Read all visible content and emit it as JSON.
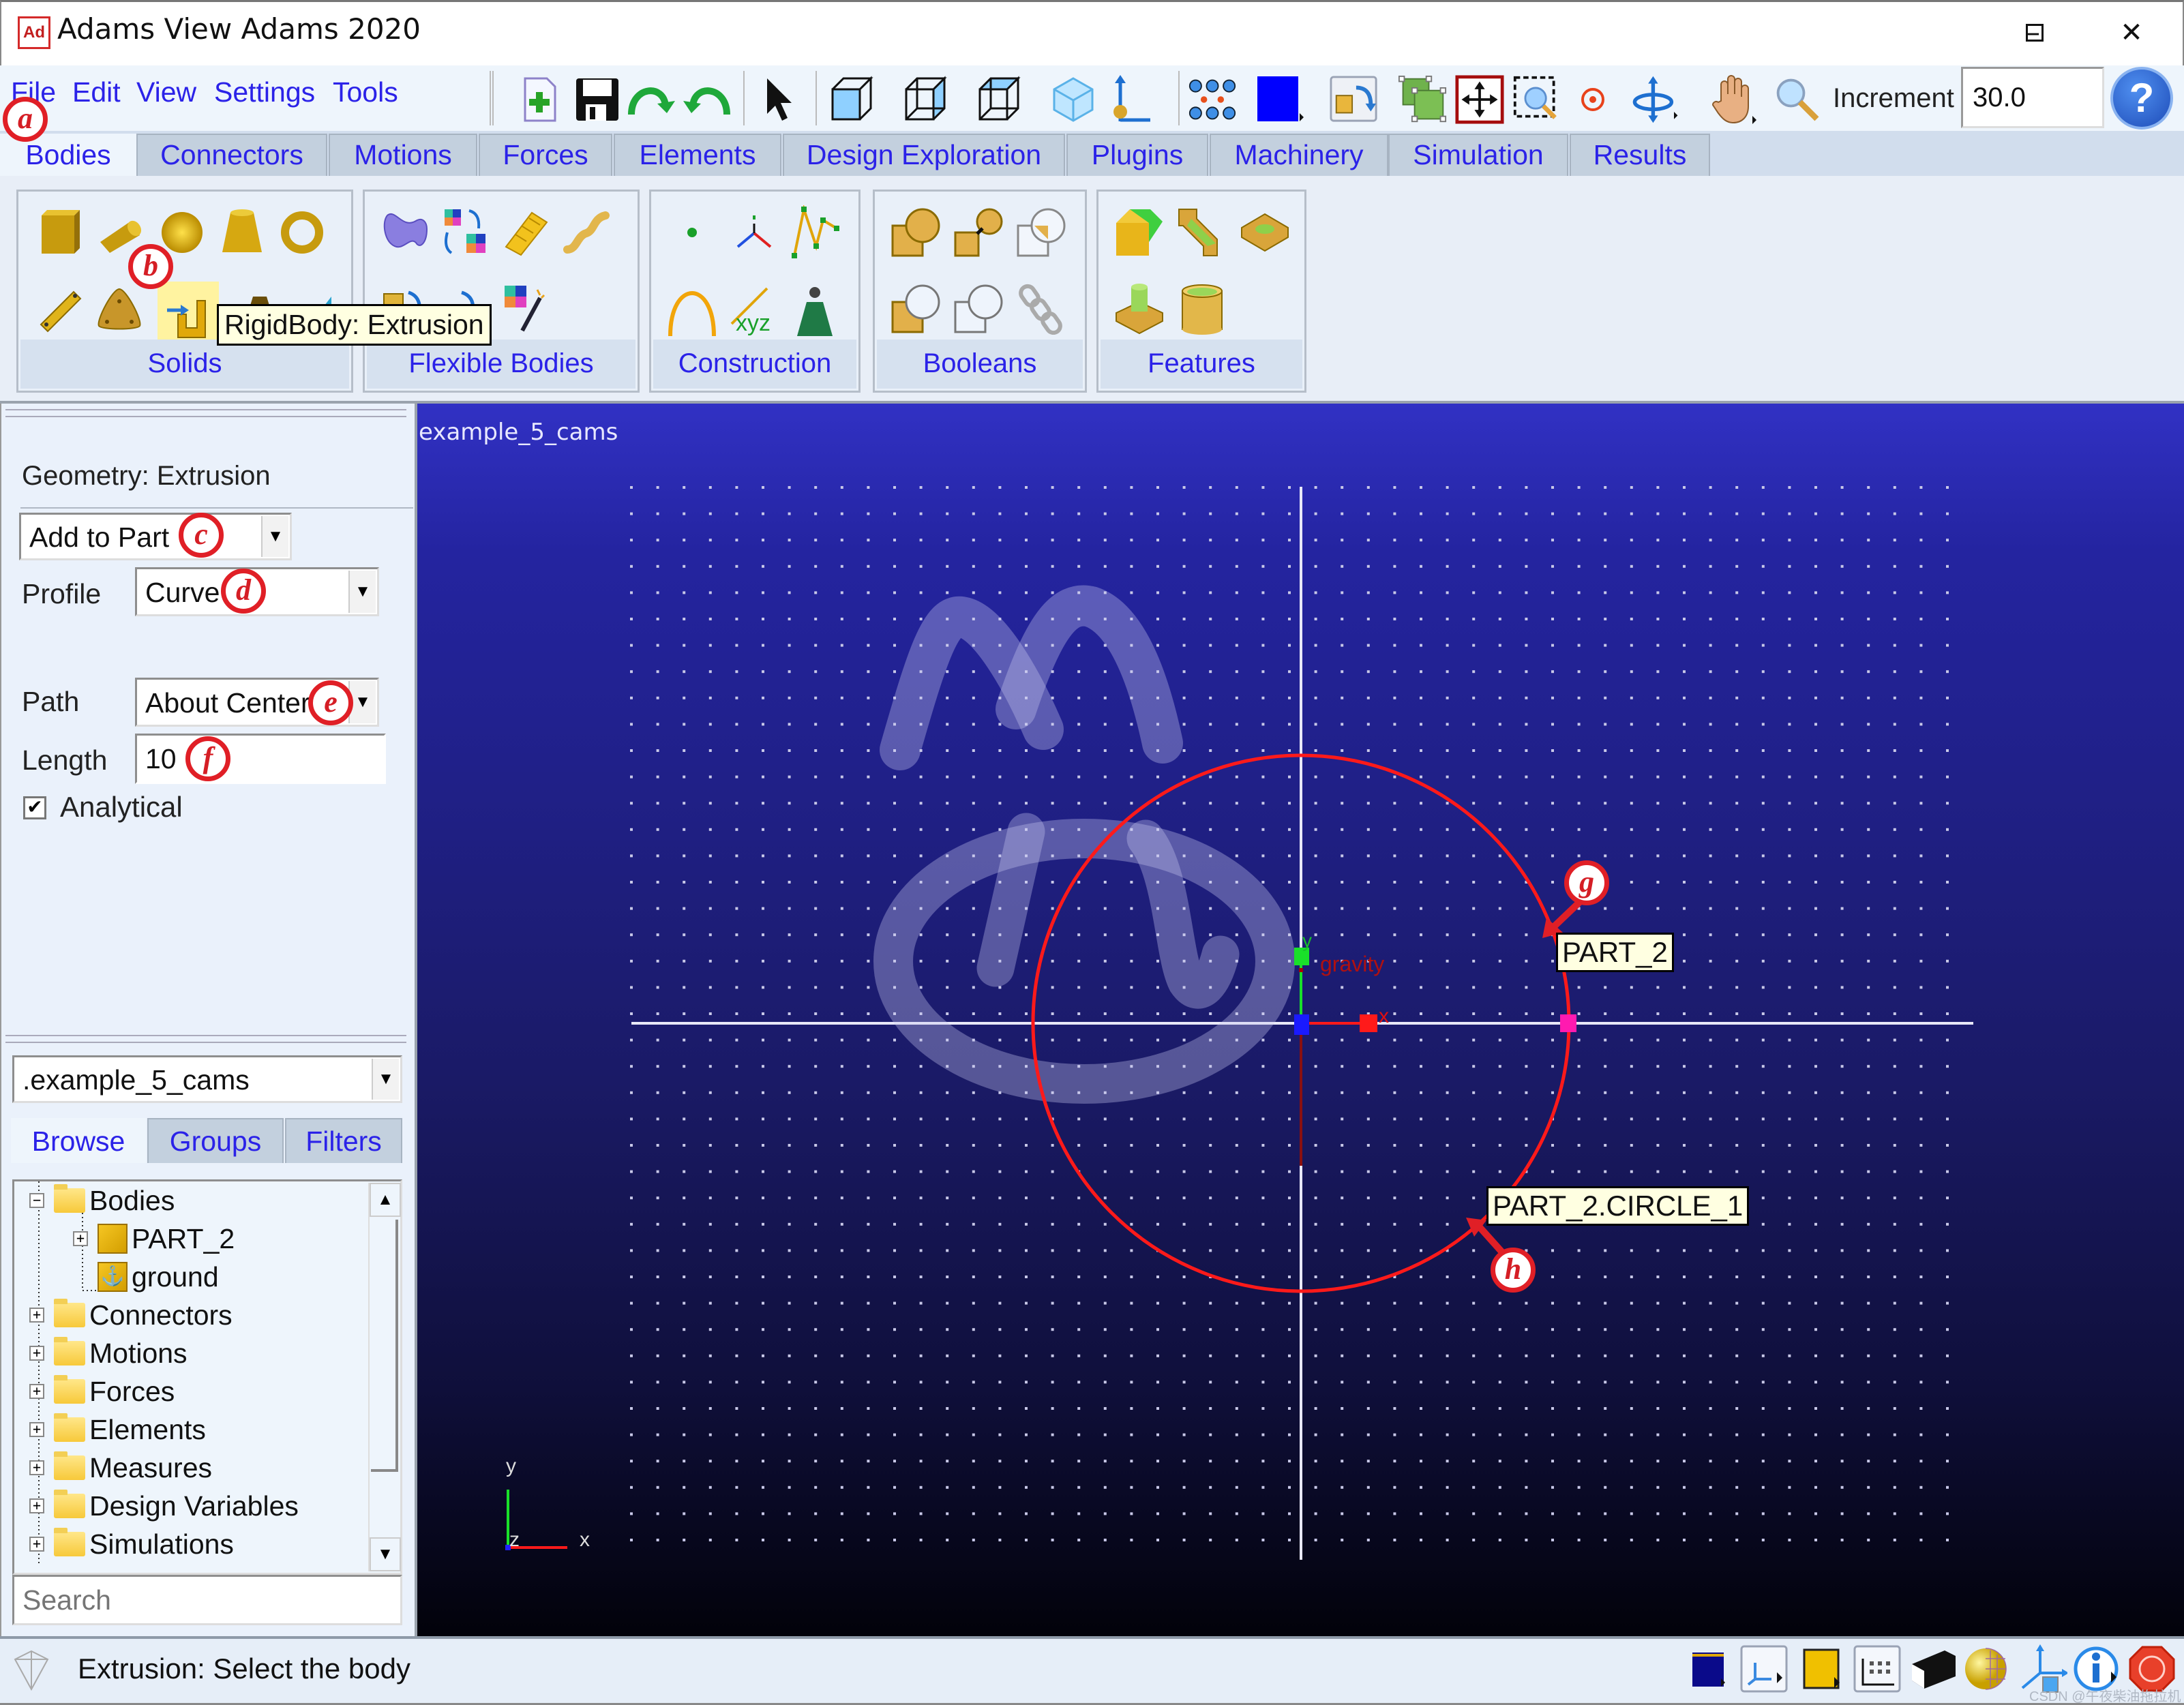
{
  "window": {
    "title": "Adams View Adams 2020",
    "logo_text": "Ad",
    "controls": {
      "minimize": "–",
      "maximize": "☐",
      "close": "✕"
    }
  },
  "menu": [
    "File",
    "Edit",
    "View",
    "Settings",
    "Tools"
  ],
  "toolbar": {
    "icons": [
      "new-model-icon",
      "save-icon",
      "undo-icon",
      "redo-icon",
      "select-pointer-icon",
      "front-view-icon",
      "right-view-icon",
      "top-view-icon",
      "iso-view-icon",
      "coordinate-system-icon",
      "grid-icon",
      "render-mode-icon",
      "toggle-icons-icon",
      "fit-selection-icon",
      "fit-all-icon",
      "zoom-box-icon",
      "center-icon",
      "rotate-icon",
      "pan-icon",
      "zoom-icon"
    ],
    "increment_label": "Increment",
    "increment_value": "30.0",
    "help_label": "?"
  },
  "tabs": [
    {
      "label": "Bodies",
      "active": true
    },
    {
      "label": "Connectors"
    },
    {
      "label": "Motions"
    },
    {
      "label": "Forces"
    },
    {
      "label": "Elements"
    },
    {
      "label": "Design Exploration"
    },
    {
      "label": "Plugins"
    },
    {
      "label": "Machinery"
    },
    {
      "label": "Simulation"
    },
    {
      "label": "Results"
    }
  ],
  "ribbon": {
    "groups": [
      {
        "label": "Solids",
        "icons": [
          "box-icon",
          "cylinder-icon",
          "sphere-icon",
          "frustum-icon",
          "torus-icon",
          "link-icon",
          "plate-icon",
          "extrusion-icon",
          "revolution-icon",
          "wedge-icon"
        ]
      },
      {
        "label": "Flexible Bodies",
        "icons": [
          "flex-body-icon",
          "rigid-to-flex-icon",
          "viewflex-icon",
          "flex-beam-icon",
          "rigid-to-flex-swap-icon",
          "flex-to-rigid-icon",
          "modal-icon"
        ]
      },
      {
        "label": "Construction",
        "icons": [
          "point-icon",
          "marker-icon",
          "polyline-icon",
          "arc-icon",
          "spline-xyz-icon",
          "chain-icon"
        ]
      },
      {
        "label": "Booleans",
        "icons": [
          "union-icon",
          "merge-icon",
          "intersect-icon",
          "cut-icon",
          "split-icon",
          "chain-link-icon"
        ]
      },
      {
        "label": "Features",
        "icons": [
          "chamfer-icon",
          "fillet-icon",
          "hole-icon",
          "boss-icon",
          "hollow-icon"
        ]
      }
    ],
    "tooltip": "RigidBody: Extrusion"
  },
  "annotations": [
    "a",
    "b",
    "c",
    "d",
    "e",
    "f",
    "g",
    "h"
  ],
  "panel": {
    "title": "Geometry: Extrusion",
    "mode": "Add to Part",
    "profile_label": "Profile",
    "profile_value": "Curve",
    "path_label": "Path",
    "path_value": "About Center",
    "length_label": "Length",
    "length_value": "10",
    "analytical_label": "Analytical",
    "analytical_checked": true
  },
  "browser": {
    "model": ".example_5_cams",
    "tabs": [
      {
        "label": "Browse",
        "active": true
      },
      {
        "label": "Groups"
      },
      {
        "label": "Filters"
      }
    ],
    "tree": [
      {
        "label": "Bodies",
        "expander": "−",
        "level": 0,
        "icon": "folder-open-icon"
      },
      {
        "label": "PART_2",
        "expander": "+",
        "level": 1,
        "icon": "part-icon"
      },
      {
        "label": "ground",
        "expander": "",
        "level": 1,
        "icon": "ground-icon"
      },
      {
        "label": "Connectors",
        "expander": "+",
        "level": 0,
        "icon": "folder-icon"
      },
      {
        "label": "Motions",
        "expander": "+",
        "level": 0,
        "icon": "folder-icon"
      },
      {
        "label": "Forces",
        "expander": "+",
        "level": 0,
        "icon": "folder-icon"
      },
      {
        "label": "Elements",
        "expander": "+",
        "level": 0,
        "icon": "folder-icon"
      },
      {
        "label": "Measures",
        "expander": "+",
        "level": 0,
        "icon": "folder-icon"
      },
      {
        "label": "Design Variables",
        "expander": "+",
        "level": 0,
        "icon": "folder-icon"
      },
      {
        "label": "Simulations",
        "expander": "+",
        "level": 0,
        "icon": "folder-icon"
      }
    ],
    "search_placeholder": "Search"
  },
  "viewport": {
    "model_name": "example_5_cams",
    "gravity_label": "gravity",
    "part_label": "PART_2",
    "circle_label": "PART_2.CIRCLE_1",
    "triad": {
      "x": "x",
      "y": "y",
      "z": "z"
    },
    "origin_axis": {
      "x": "x",
      "y": "y"
    }
  },
  "status": {
    "text": "Extrusion: Select the body",
    "icons": [
      "background-color-icon",
      "coordinate-window-icon",
      "object-color-icon",
      "view-grid-icon",
      "render-icon",
      "shading-icon",
      "triad-icon",
      "info-icon",
      "stop-icon"
    ]
  },
  "watermark": "CSDN @午夜柴油拖拉机",
  "colors": {
    "accent_text": "#2b22e8",
    "annotation_red": "#e01f26",
    "circle_red": "#ff1a1a",
    "viewport_top": "#3131c4",
    "viewport_bottom": "#02020a"
  }
}
